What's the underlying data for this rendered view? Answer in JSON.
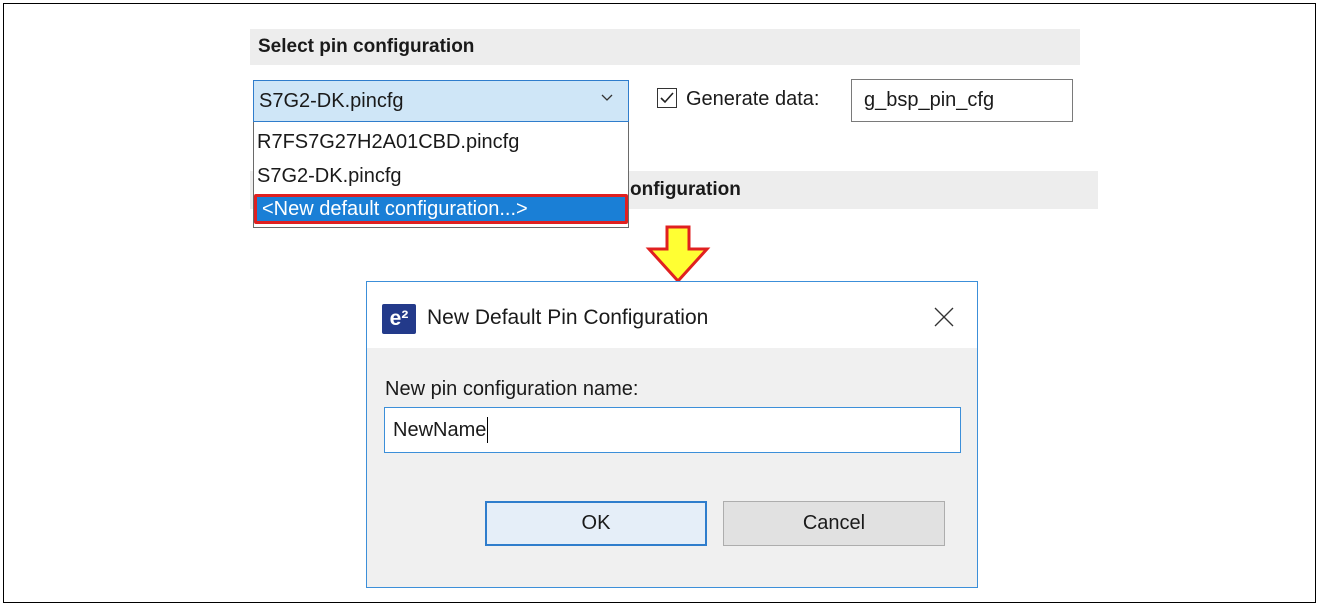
{
  "sections": {
    "select_pin_config_header": "Select pin configuration",
    "partial_header_text": "onfiguration"
  },
  "combo": {
    "selected_value": "S7G2-DK.pincfg",
    "options": [
      "R7FS7G27H2A01CBD.pincfg",
      "S7G2-DK.pincfg",
      "<New default configuration...>"
    ]
  },
  "generate": {
    "label": "Generate data:",
    "value": "g_bsp_pin_cfg",
    "checked": true
  },
  "arrow_colors": {
    "fill": "#ffff33",
    "stroke": "#e02020"
  },
  "dialog": {
    "logo_text": "e²",
    "title": "New Default Pin Configuration",
    "field_label": "New pin configuration name:",
    "field_value": "NewName",
    "ok_label": "OK",
    "cancel_label": "Cancel"
  }
}
